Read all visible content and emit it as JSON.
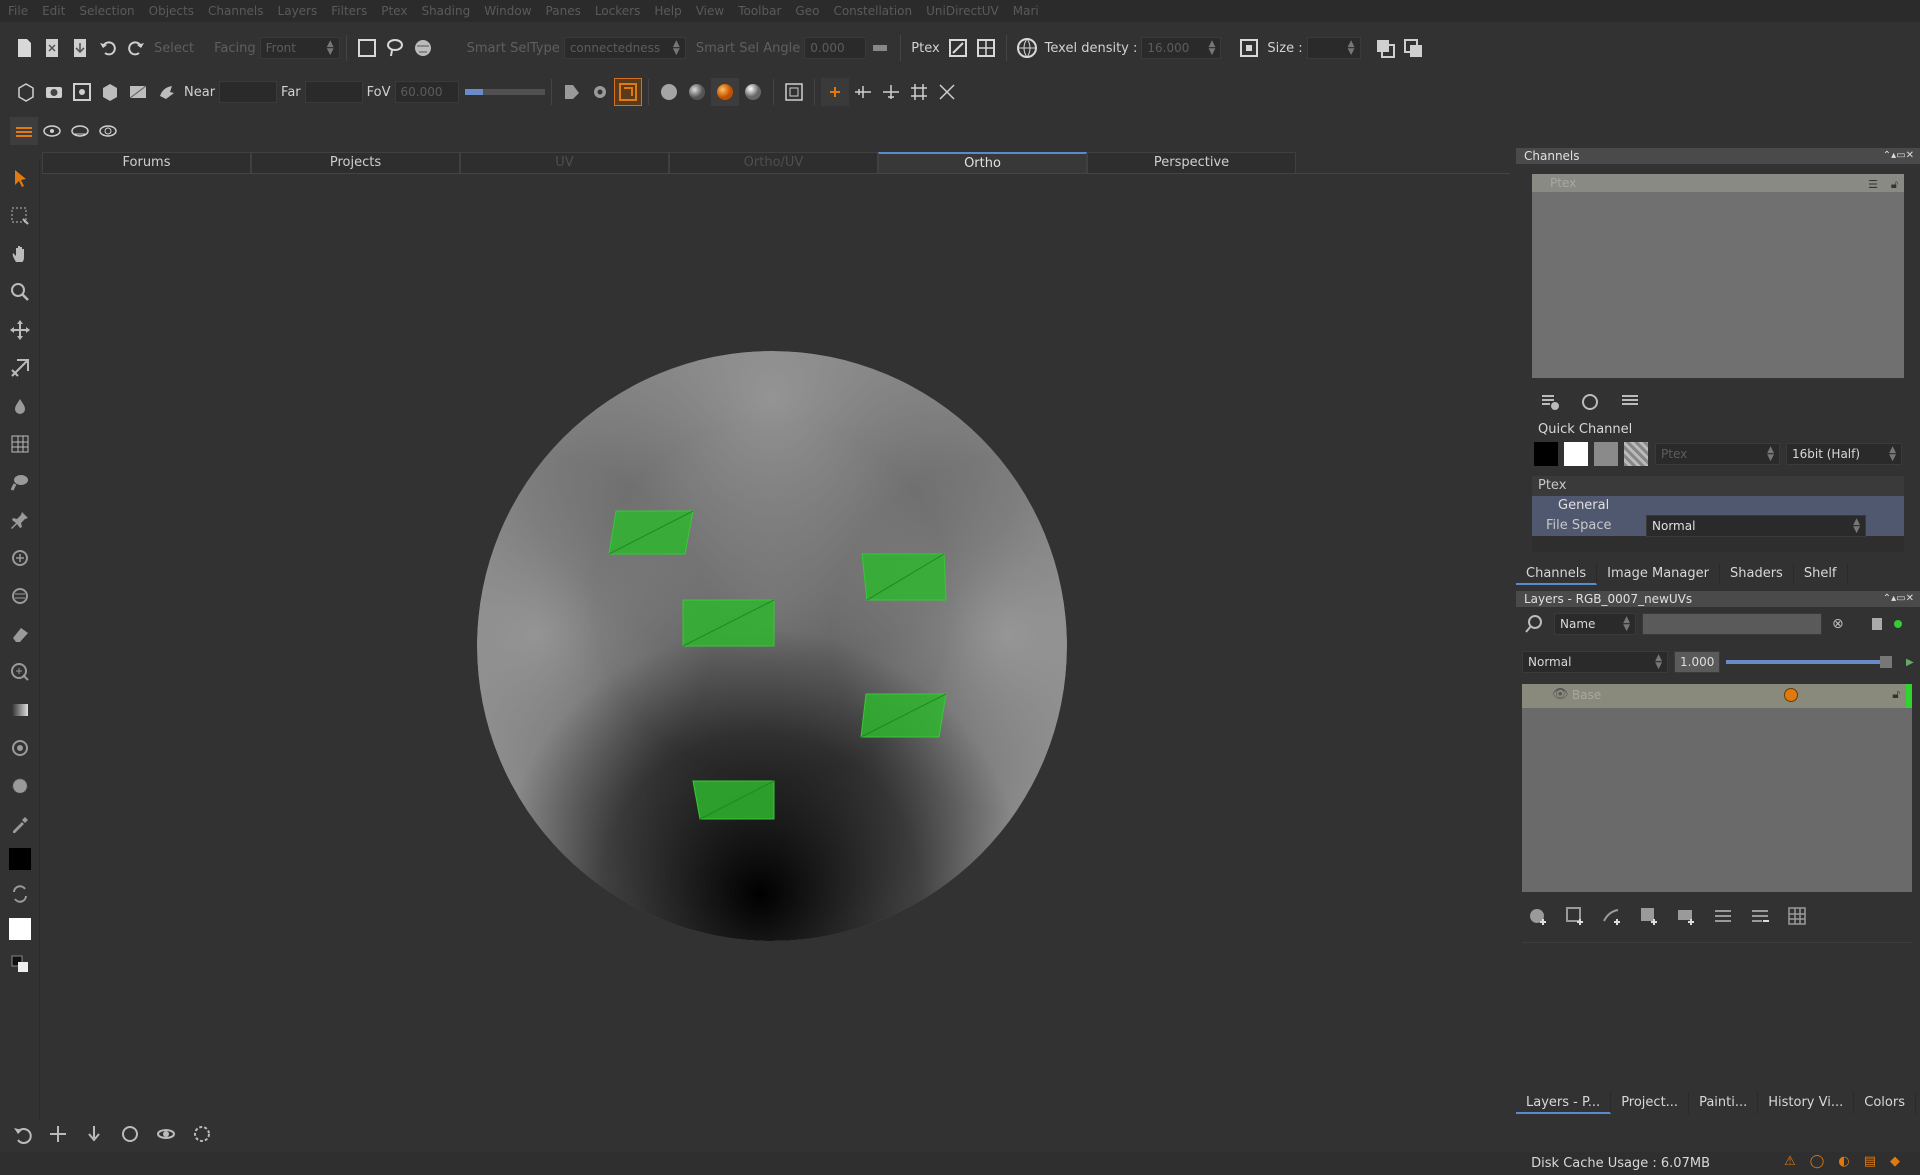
{
  "menubar": {
    "items": [
      "File",
      "Edit",
      "Selection",
      "Objects",
      "Channels",
      "Layers",
      "Filters",
      "Ptex",
      "Shading",
      "Window",
      "Panes",
      "Lockers",
      "Help",
      "View",
      "Toolbar",
      "Geo",
      "Constellation",
      "UniDirectUV",
      "Mari"
    ]
  },
  "toolbar1": {
    "select_label": "Select",
    "facing_label": "Facing",
    "facing_value": "Front",
    "smart_sel_type_label": "Smart SelType",
    "smart_sel_type_value": "connectedness",
    "smart_sel_angle_label": "Smart Sel Angle",
    "smart_sel_angle_value": "0.000",
    "ptex_label": "Ptex",
    "texel_density_label": "Texel density :",
    "texel_density_value": "16.000",
    "size_label": "Size :",
    "size_value": ""
  },
  "toolbar2": {
    "near_label": "Near",
    "near_value": "",
    "far_label": "Far",
    "far_value": "",
    "fov_label": "FoV",
    "fov_value": "60.000"
  },
  "viewport_tabs": [
    {
      "label": "Forums",
      "state": "normal"
    },
    {
      "label": "Projects",
      "state": "normal"
    },
    {
      "label": "UV",
      "state": "dim"
    },
    {
      "label": "Ortho/UV",
      "state": "dim"
    },
    {
      "label": "Ortho",
      "state": "active"
    },
    {
      "label": "Perspective",
      "state": "normal"
    }
  ],
  "channels_panel": {
    "title": "Channels",
    "channel_item": "Ptex",
    "quick_channel_label": "Quick Channel",
    "quick_channel_name": "Ptex",
    "quick_channel_depth": "16bit (Half)",
    "props_header": "Ptex",
    "props_group": "General",
    "file_space_label": "File Space",
    "file_space_value": "Normal"
  },
  "panel_tabs_top": [
    "Channels",
    "Image Manager",
    "Shaders",
    "Shelf"
  ],
  "layers_panel": {
    "title": "Layers - RGB_0007_newUVs",
    "filter_field": "Name",
    "blend_mode": "Normal",
    "opacity": "1.000",
    "layer_name": "Base"
  },
  "panel_tabs_bottom": [
    "Layers - P...",
    "Project...",
    "Painti...",
    "History Vi...",
    "Colors"
  ],
  "status": {
    "disk_cache": "Disk Cache Usage : 6.07MB"
  },
  "colors": {
    "accent_orange": "#e07a10",
    "selection_green": "#2fb52f",
    "active_tab_blue": "#5a8ad0"
  }
}
